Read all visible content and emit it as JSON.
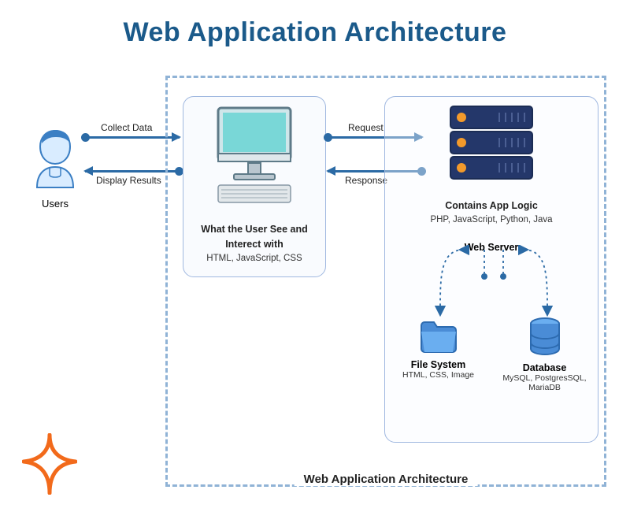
{
  "title": "Web Application Architecture",
  "outer_box_label": "Web Application Architecture",
  "users": {
    "label": "Users"
  },
  "arrows": {
    "collect": "Collect Data",
    "display": "Display Results",
    "request": "Request",
    "response": "Response"
  },
  "frontend": {
    "caption_line1": "What the User See and",
    "caption_line2": "Interect with",
    "sub": "HTML, JavaScript, CSS"
  },
  "backend": {
    "logic_caption": "Contains App Logic",
    "logic_sub": "PHP, JavaScript, Python, Java",
    "webserver_label": "Web Server",
    "filesystem": {
      "title": "File System",
      "sub": "HTML, CSS, Image"
    },
    "database": {
      "title": "Database",
      "sub": "MySQL, PostgresSQL, MariaDB"
    }
  }
}
